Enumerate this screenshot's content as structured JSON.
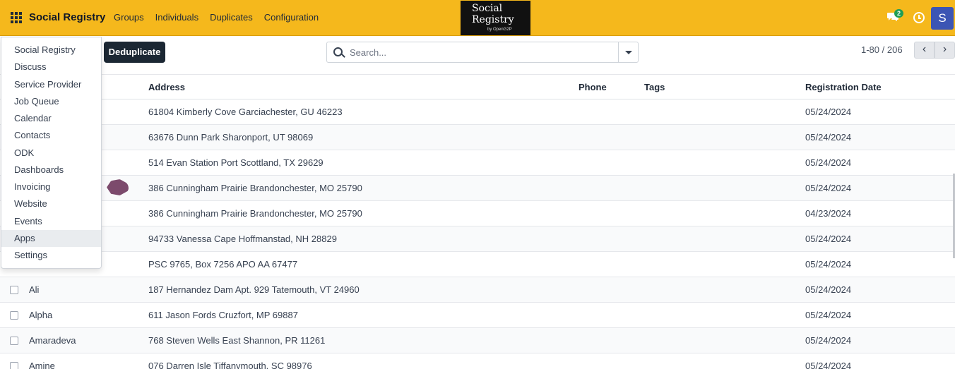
{
  "navbar": {
    "brand": "Social Registry",
    "menu": [
      "Groups",
      "Individuals",
      "Duplicates",
      "Configuration"
    ],
    "logo": {
      "line1": "Social",
      "line2": "Registry",
      "line3": "by OpenG2P"
    },
    "messages_count": "2",
    "avatar_initial": "S",
    "accent_color": "#f5b81c"
  },
  "toolbar": {
    "deduplicate_label": "Deduplicate",
    "search_placeholder": "Search...",
    "pager_text": "1-80 / 206",
    "prev_icon": "chevron-left-icon",
    "next_icon": "chevron-right-icon"
  },
  "table": {
    "headers": {
      "address": "Address",
      "phone": "Phone",
      "tags": "Tags",
      "registration_date": "Registration Date"
    },
    "rows": [
      {
        "name": "",
        "address": "61804 Kimberly Cove Garciachester, GU 46223",
        "phone": "",
        "tags": "",
        "date": "05/24/2024"
      },
      {
        "name": "",
        "address": "63676 Dunn Park Sharonport, UT 98069",
        "phone": "",
        "tags": "",
        "date": "05/24/2024"
      },
      {
        "name": "",
        "address": "514 Evan Station Port Scottland, TX 29629",
        "phone": "",
        "tags": "",
        "date": "05/24/2024"
      },
      {
        "name": "",
        "address": "386 Cunningham Prairie Brandonchester, MO 25790",
        "phone": "",
        "tags": "",
        "date": "05/24/2024"
      },
      {
        "name": "",
        "address": "386 Cunningham Prairie Brandonchester, MO 25790",
        "phone": "",
        "tags": "",
        "date": "04/23/2024"
      },
      {
        "name": "",
        "address": "94733 Vanessa Cape Hoffmanstad, NH 28829",
        "phone": "",
        "tags": "",
        "date": "05/24/2024"
      },
      {
        "name": "",
        "address": "PSC 9765, Box 7256 APO AA 67477",
        "phone": "",
        "tags": "",
        "date": "05/24/2024"
      },
      {
        "name": "Ali",
        "address": "187 Hernandez Dam Apt. 929 Tatemouth, VT 24960",
        "phone": "",
        "tags": "",
        "date": "05/24/2024"
      },
      {
        "name": "Alpha",
        "address": "611 Jason Fords Cruzfort, MP 69887",
        "phone": "",
        "tags": "",
        "date": "05/24/2024"
      },
      {
        "name": "Amaradeva",
        "address": "768 Steven Wells East Shannon, PR 11261",
        "phone": "",
        "tags": "",
        "date": "05/24/2024"
      },
      {
        "name": "Amine",
        "address": "076 Darren Isle Tiffanymouth, SC 98976",
        "phone": "",
        "tags": "",
        "date": "05/24/2024"
      }
    ]
  },
  "apps_menu": {
    "items": [
      "Social Registry",
      "Discuss",
      "Service Provider",
      "Job Queue",
      "Calendar",
      "Contacts",
      "ODK",
      "Dashboards",
      "Invoicing",
      "Website",
      "Events",
      "Apps",
      "Settings"
    ],
    "active": "Apps"
  }
}
